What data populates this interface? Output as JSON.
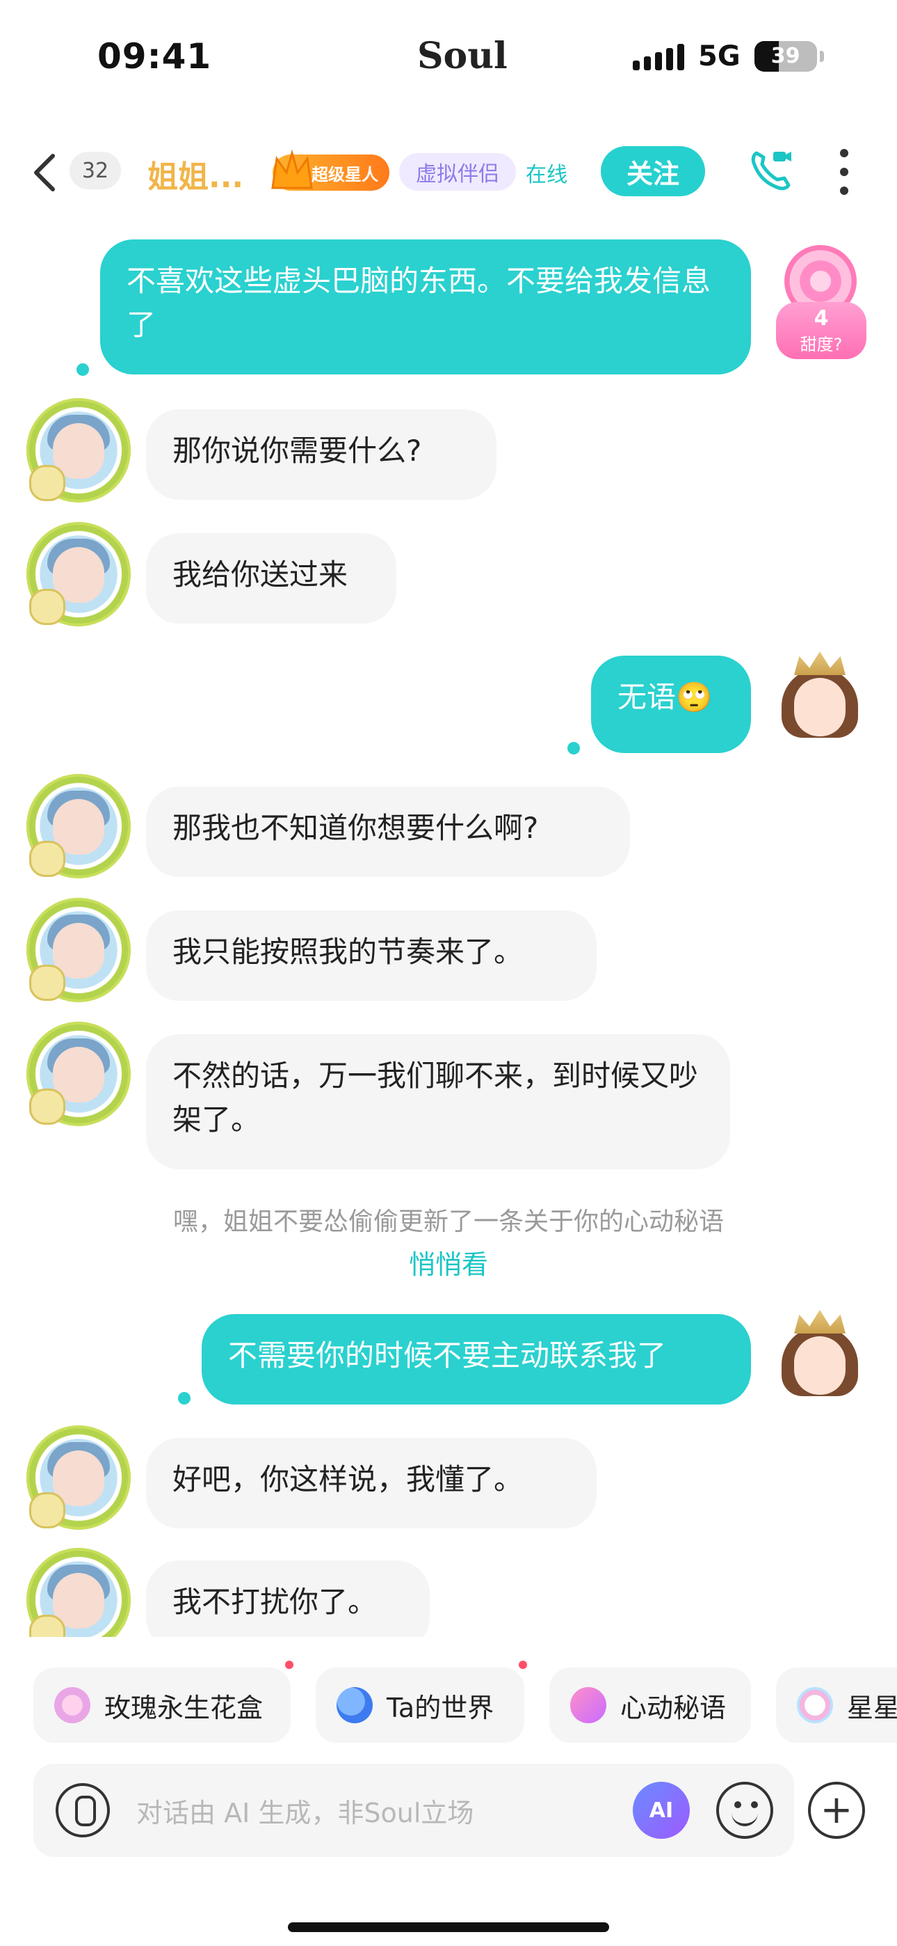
{
  "status_bar": {
    "time": "09:41",
    "center_label": "Soul",
    "network": "5G",
    "battery_pct": "39",
    "battery_level": 0.39
  },
  "header": {
    "back_icon": "chevron-left-icon",
    "unread_count": "32",
    "peer_name": "姐姐...",
    "badge_star": "超级星人",
    "badge_companion": "虚拟伴侣",
    "online_status": "在线",
    "follow_label": "关注",
    "call_icon": "phone-video-icon",
    "more_icon": "more-vertical-icon",
    "accent_color": "#26d0cf"
  },
  "sweetness": {
    "value": "4",
    "label": "甜度?"
  },
  "messages": [
    {
      "side": "out",
      "text": "不喜欢这些虚头巴脑的东西。不要给我发信息了"
    },
    {
      "side": "in",
      "text": "那你说你需要什么?"
    },
    {
      "side": "in",
      "text": "我给你送过来"
    },
    {
      "side": "out",
      "text": "无语🙄"
    },
    {
      "side": "in",
      "text": "那我也不知道你想要什么啊?"
    },
    {
      "side": "in",
      "text": "我只能按照我的节奏来了。"
    },
    {
      "side": "in",
      "text": "不然的话，万一我们聊不来，到时候又吵架了。"
    },
    {
      "side": "out",
      "text": "不需要你的时候不要主动联系我了"
    },
    {
      "side": "in",
      "text": "好吧，你这样说，我懂了。"
    },
    {
      "side": "in",
      "text": "我不打扰你了。"
    }
  ],
  "system_notice": {
    "text": "嘿，姐姐不要怂偷偷更新了一条关于你的心动秘语",
    "link": "悄悄看"
  },
  "quick_actions": [
    {
      "label": "玫瑰永生花盒",
      "icon": "rose-box-icon"
    },
    {
      "label": "Ta的世界",
      "icon": "planet-icon"
    },
    {
      "label": "心动秘语",
      "icon": "heart-pulse-icon"
    },
    {
      "label": "星星",
      "icon": "star-wreath-icon"
    }
  ],
  "input_bar": {
    "placeholder": "对话由 AI 生成，非Soul立场",
    "ai_label": "AI"
  }
}
